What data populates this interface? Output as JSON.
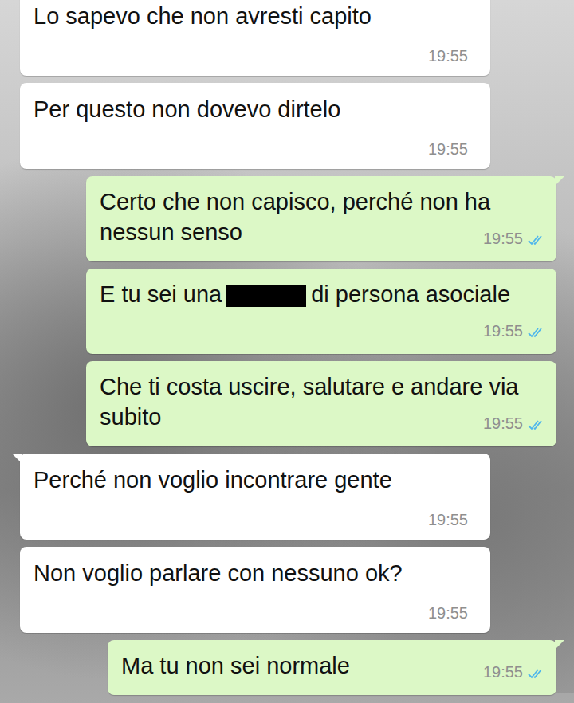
{
  "chat": {
    "messages": [
      {
        "kind": "incoming",
        "segments": [
          {
            "kind": "text",
            "text": "Lo sapevo che non avresti capito"
          }
        ],
        "time": "19:55",
        "read": false
      },
      {
        "kind": "incoming",
        "segments": [
          {
            "kind": "text",
            "text": "Per questo non dovevo dirtelo"
          }
        ],
        "time": "19:55",
        "read": false
      },
      {
        "kind": "outgoing",
        "segments": [
          {
            "kind": "text",
            "text": "Certo che non capisco, perché non ha nessun senso"
          }
        ],
        "time": "19:55",
        "read": true
      },
      {
        "kind": "outgoing",
        "segments": [
          {
            "kind": "text",
            "text": "E tu sei una"
          },
          {
            "kind": "redaction",
            "text": ""
          },
          {
            "kind": "text",
            "text": "di persona asociale"
          }
        ],
        "time": "19:55",
        "read": true
      },
      {
        "kind": "outgoing",
        "segments": [
          {
            "kind": "text",
            "text": "Che ti costa uscire, salutare e andare via subito"
          }
        ],
        "time": "19:55",
        "read": true
      },
      {
        "kind": "incoming",
        "segments": [
          {
            "kind": "text",
            "text": "Perché non voglio incontrare gente"
          }
        ],
        "time": "19:55",
        "read": false
      },
      {
        "kind": "incoming",
        "segments": [
          {
            "kind": "text",
            "text": "Non voglio parlare con nessuno ok?"
          }
        ],
        "time": "19:55",
        "read": false
      },
      {
        "kind": "outgoing",
        "segments": [
          {
            "kind": "text",
            "text": "Ma tu non sei normale"
          }
        ],
        "time": "19:55",
        "read": true
      }
    ]
  }
}
